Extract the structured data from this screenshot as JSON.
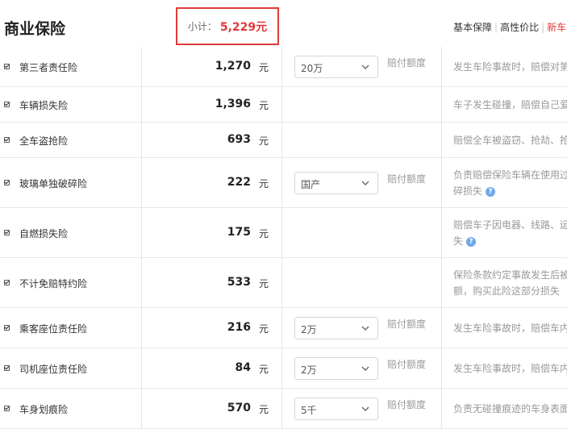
{
  "header": {
    "title": "商业保险",
    "subtotal_label": "小计：",
    "subtotal_value": "5,229元",
    "tabs": [
      "基本保障",
      "高性价比",
      "新车"
    ]
  },
  "currency_unit": "元",
  "coverage_label": "赔付额度",
  "rows": [
    {
      "name": "第三者责任险",
      "price": "1,270",
      "select": "20万",
      "desc": [
        "发生车险事故时，赔偿对第"
      ]
    },
    {
      "name": "车辆损失险",
      "price": "1,396",
      "select": null,
      "desc": [
        "车子发生碰撞，赔偿自己爱"
      ]
    },
    {
      "name": "全车盗抢险",
      "price": "693",
      "select": null,
      "desc": [
        "赔偿全车被盗窃、抢劫、抢"
      ]
    },
    {
      "name": "玻璃单独破碎险",
      "price": "222",
      "select": "国产",
      "desc": [
        "负责赔偿保险车辆在使用过",
        "碎损失"
      ],
      "help": true
    },
    {
      "name": "自燃损失险",
      "price": "175",
      "select": null,
      "desc": [
        "赔偿车子因电器、线路、运",
        "失"
      ],
      "help": true
    },
    {
      "name": "不计免赔特约险",
      "price": "533",
      "select": null,
      "desc": [
        "保险条款约定事故发生后被",
        "额，购买此险这部分损失"
      ]
    },
    {
      "name": "乘客座位责任险",
      "price": "216",
      "select": "2万",
      "desc": [
        "发生车险事故时，赔偿车内"
      ]
    },
    {
      "name": "司机座位责任险",
      "price": "84",
      "select": "2万",
      "desc": [
        "发生车险事故时，赔偿车内"
      ]
    },
    {
      "name": "车身划痕险",
      "price": "570",
      "select": "5千",
      "desc": [
        "负责无碰撞痕迹的车身表面"
      ]
    }
  ]
}
